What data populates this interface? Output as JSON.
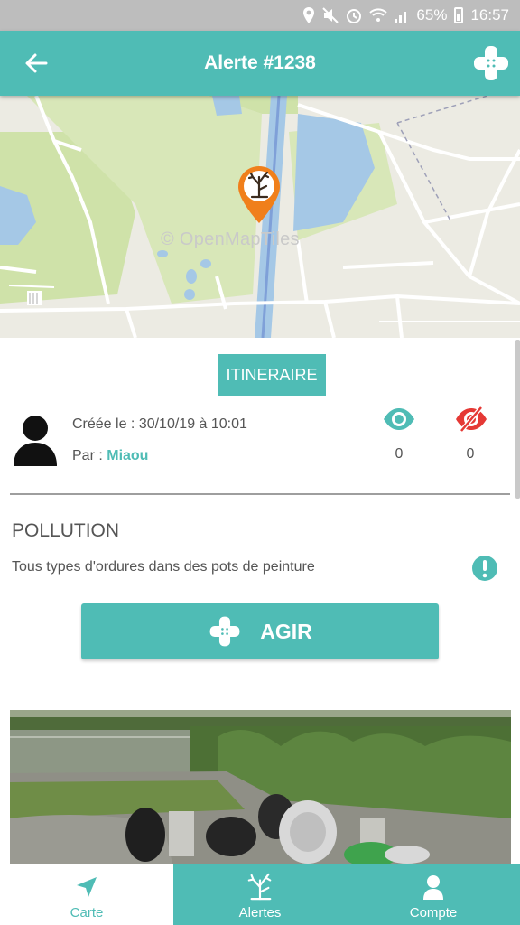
{
  "status_bar": {
    "battery": "65%",
    "time": "16:57"
  },
  "app_bar": {
    "title": "Alerte #1238"
  },
  "map": {
    "attribution": "© OpenMapTiles"
  },
  "actions": {
    "itinerary_label": "ITINERAIRE",
    "agir_label": "AGIR"
  },
  "alert": {
    "created_label": "Créée le : 30/10/19 à 10:01",
    "by_prefix": "Par : ",
    "author": "Miaou",
    "seen_count": "0",
    "not_seen_count": "0",
    "category": "POLLUTION",
    "description": "Tous types d'ordures dans des pots de peinture"
  },
  "bottom_nav": {
    "items": [
      {
        "label": "Carte",
        "icon": "navigation-arrow-icon"
      },
      {
        "label": "Alertes",
        "icon": "dead-tree-icon"
      },
      {
        "label": "Compte",
        "icon": "person-icon"
      }
    ]
  },
  "colors": {
    "primary": "#4fbcb5",
    "pin": "#f07f1b",
    "hidden_eye": "#e53935",
    "status_bar": "#bdbdbd"
  }
}
